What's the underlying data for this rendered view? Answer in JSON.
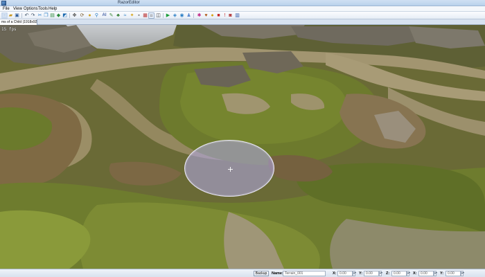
{
  "window": {
    "title": "RazorEditor"
  },
  "menu": {
    "items": [
      "File",
      "View",
      "Options",
      "Tools",
      "Help"
    ]
  },
  "toolbar": {
    "icons": [
      "new-icon",
      "open-icon",
      "save-icon",
      "undo-icon",
      "redo-icon",
      "cut-icon",
      "copy-icon",
      "paste-icon",
      "delete-icon",
      "select-icon",
      "move-icon",
      "rotate-icon",
      "scale-icon",
      "zoom-icon",
      "terrain-icon",
      "paint-icon",
      "tree-icon",
      "water-icon",
      "light-icon",
      "camera-icon",
      "grid-icon",
      "snap-icon",
      "script-icon",
      "play-icon",
      "settings-icon",
      "help-icon"
    ]
  },
  "document": {
    "tab": "ms of a Child (1918x927)",
    "fps": "15 fps"
  },
  "status": {
    "backup": "Backup",
    "name_label": "Name:",
    "name_value": "Terrain_001",
    "x_label": "X:",
    "x_value": "0.00",
    "y_label": "Y:",
    "y_value": "0.00",
    "z_label": "Z:",
    "z_value": "0.00",
    "rx_label": "X:",
    "rx_value": "0.00",
    "ry_label": "Y:",
    "ry_value": "0.00"
  },
  "colors": {
    "accent": "#3a6ea5",
    "brush": "#b2aaeb",
    "grass": "#5f6e2b",
    "path": "#a99a72"
  }
}
